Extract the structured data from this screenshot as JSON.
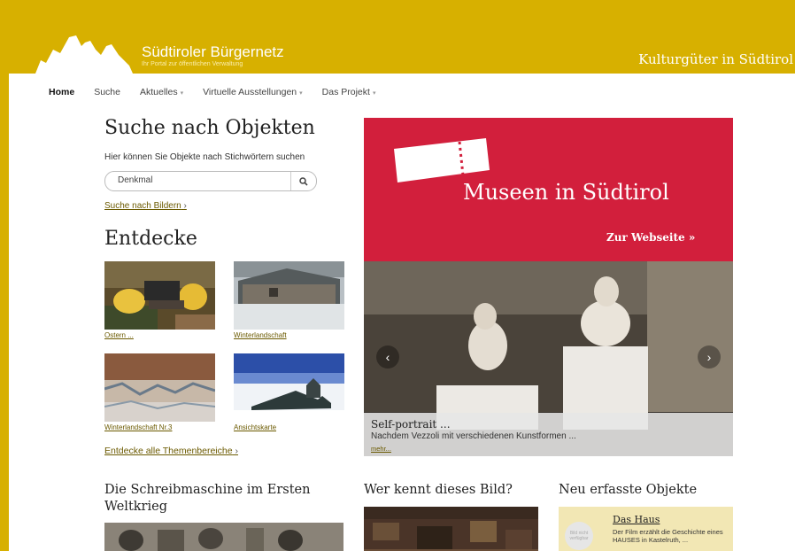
{
  "header": {
    "brand_title": "Südtiroler Bürgernetz",
    "brand_subtitle": "Ihr Portal zur öffentlichen Verwaltung",
    "site_title": "Kulturgüter in Südtirol"
  },
  "nav": {
    "items": [
      {
        "label": "Home",
        "dropdown": false
      },
      {
        "label": "Suche",
        "dropdown": false
      },
      {
        "label": "Aktuelles",
        "dropdown": true
      },
      {
        "label": "Virtuelle Ausstellungen",
        "dropdown": true
      },
      {
        "label": "Das Projekt",
        "dropdown": true
      }
    ],
    "caret": "▾"
  },
  "search": {
    "heading": "Suche nach Objekten",
    "description": "Hier können Sie Objekte nach Stichwörtern suchen",
    "value": "Denkmal",
    "image_search_link": "Suche nach Bildern",
    "link_arrow": "›"
  },
  "discover": {
    "heading": "Entdecke",
    "items": [
      {
        "label": "Ostern ..."
      },
      {
        "label": "Winterlandschaft"
      },
      {
        "label": "Winterlandschaft Nr.3"
      },
      {
        "label": "Ansichtskarte"
      }
    ],
    "all_link": "Entdecke alle Themenbereiche",
    "link_arrow": "›"
  },
  "promo": {
    "title": "Museen in Südtirol",
    "link": "Zur  Webseite »",
    "color": "#d21f3c"
  },
  "carousel": {
    "prev": "‹",
    "next": "›",
    "caption_title": "Self-portrait ...",
    "caption_text": "Nachdem Vezzoli mit verschiedenen Kunstformen ...",
    "more_link": "mehr..."
  },
  "bottom": {
    "typewriter_heading_line1": "Die Schreibmaschine im Ersten",
    "typewriter_heading_line2": "Weltkrieg",
    "who_knows_heading": "Wer kennt dieses Bild?",
    "new_objects_heading": "Neu erfasste Objekte",
    "new_object": {
      "placeholder_line1": "Bild nicht",
      "placeholder_line2": "verfügbar",
      "title": "Das Haus",
      "text": "Der Film erzählt die Geschichte eines HAUSES in Kastelruth, ..."
    }
  },
  "colors": {
    "accent": "#d7b000",
    "link": "#6b5a00"
  }
}
